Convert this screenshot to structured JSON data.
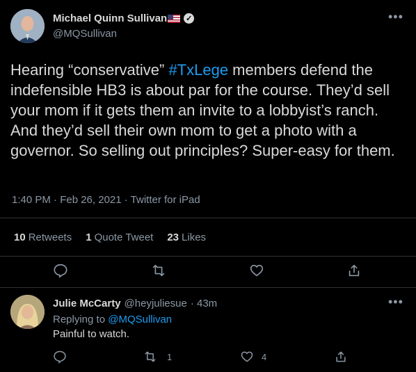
{
  "tweet": {
    "author_name": "Michael Quinn Sullivan",
    "author_handle": "@MQSullivan",
    "text_before": "Hearing “conservative” ",
    "hashtag": "#TxLege",
    "text_after": " members defend the indefensible HB3 is about par for the course. They’d sell your mom if it gets them an invite to a lobbyist’s ranch. And they’d sell their own mom to get a photo with a governor. So selling out principles? Super-easy for them.",
    "meta": "1:40 PM · Feb 26, 2021 · Twitter for iPad",
    "stats": {
      "retweets_count": "10",
      "retweets_label": "Retweets",
      "quotes_count": "1",
      "quotes_label": "Quote Tweet",
      "likes_count": "23",
      "likes_label": "Likes"
    }
  },
  "reply": {
    "author_name": "Julie McCarty",
    "author_handle": "@heyjuliesue",
    "time": "· 43m",
    "replying_prefix": "Replying to ",
    "replying_to": "@MQSullivan",
    "text": "Painful to watch.",
    "retweet_count": "1",
    "like_count": "4"
  },
  "colors": {
    "background": "#000000",
    "text": "#d9d9d9",
    "muted": "#8b98a5",
    "link": "#1d9bf0",
    "border": "#2f3336"
  },
  "icons": [
    "verified-badge-icon",
    "us-flag-icon",
    "more-icon",
    "reply-icon",
    "retweet-icon",
    "like-icon",
    "share-icon"
  ]
}
